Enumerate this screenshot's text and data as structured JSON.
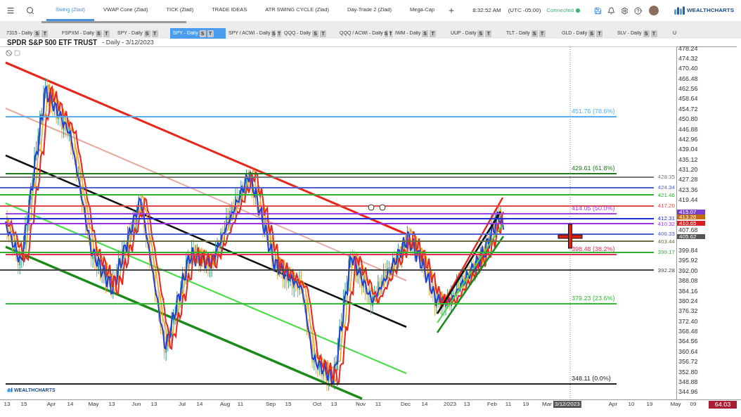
{
  "top_bar": {
    "layouts": [
      {
        "label": "Swing (Ziad)",
        "selected": true
      },
      {
        "label": "VWAP Cone (Ziad)",
        "selected": false
      },
      {
        "label": "TICK (Ziad)",
        "selected": false
      },
      {
        "label": "TRADE IDEAS",
        "selected": false
      },
      {
        "label": "ATR SWING CYCLE (Ziad)",
        "selected": false
      },
      {
        "label": "Day-Trade 2 (Ziad)",
        "selected": false
      },
      {
        "label": "Mega-Cap",
        "selected": false
      }
    ],
    "time": "8:32:52 AM",
    "timezone": "(UTC -05:00)",
    "status": "Connected",
    "connected": true,
    "logo": "WEALTHCHARTS"
  },
  "chart_tabs": [
    {
      "label": "7315 - Daily",
      "buttons": [
        "S",
        "T"
      ],
      "selected": false
    },
    {
      "label": "FSPXM - Daily",
      "buttons": [
        "S",
        "T"
      ],
      "selected": false
    },
    {
      "label": "SPY - Daily",
      "buttons": [
        "S",
        "T"
      ],
      "selected": false
    },
    {
      "label": "SPY - Daily",
      "buttons": [
        "S",
        "T"
      ],
      "selected": true
    },
    {
      "label": "SPY / ACWI - Daily",
      "buttons": [
        "S",
        "T"
      ],
      "selected": false
    },
    {
      "label": "QQQ - Daily",
      "buttons": [
        "S",
        "T"
      ],
      "selected": false
    },
    {
      "label": "QQQ / ACWI - Daily",
      "buttons": [
        "S",
        "T"
      ],
      "selected": false
    },
    {
      "label": "IWM - Daily",
      "buttons": [
        "S",
        "T"
      ],
      "selected": false
    },
    {
      "label": "UUP - Daily",
      "buttons": [
        "S",
        "T"
      ],
      "selected": false
    },
    {
      "label": "TLT - Daily",
      "buttons": [
        "S",
        "T"
      ],
      "selected": false
    },
    {
      "label": "GLD - Daily",
      "buttons": [
        "S",
        "T"
      ],
      "selected": false
    },
    {
      "label": "SLV - Daily",
      "buttons": [
        "S",
        "T"
      ],
      "selected": false
    },
    {
      "label": "U",
      "selected": false
    }
  ],
  "chart": {
    "title": "SPDR S&P 500 ETF TRUST",
    "subtitle": "- Daily - 3/12/2023",
    "watermark": "WEALTHCHARTS",
    "fib_levels": [
      {
        "label": "451.76 (78.6%)",
        "color": "#5aaef0"
      },
      {
        "label": "429.61 (61.8%)",
        "color": "#1f7a1f"
      },
      {
        "label": "414.05 (50.0%)",
        "color": "#a040e0"
      },
      {
        "label": "398.48 (38.2%)",
        "color": "#e0304f"
      },
      {
        "label": "379.23 (23.6%)",
        "color": "#33bb33"
      },
      {
        "label": "348.11 (0.0%)",
        "color": "#222222"
      }
    ],
    "levels": [
      {
        "label": "428.35",
        "color": "#777777"
      },
      {
        "label": "424.34",
        "color": "#5060d0"
      },
      {
        "label": "421.46",
        "color": "#30b030"
      },
      {
        "label": "417.20",
        "color": "#e04848"
      },
      {
        "label": "412.31",
        "color": "#2030d0"
      },
      {
        "label": "410.32",
        "color": "#9b30e0"
      },
      {
        "label": "406.33",
        "color": "#5060d0"
      },
      {
        "label": "403.44",
        "color": "#6b6b40"
      },
      {
        "label": "399.17",
        "color": "#30b030"
      },
      {
        "label": "392.28",
        "color": "#444444"
      }
    ],
    "price_axis": [
      "478.24",
      "474.32",
      "470.40",
      "466.48",
      "462.56",
      "458.64",
      "454.72",
      "450.80",
      "446.88",
      "442.96",
      "439.04",
      "435.12",
      "431.20",
      "427.28",
      "423.36",
      "419.44",
      "407.68",
      "399.84",
      "395.92",
      "392.00",
      "388.08",
      "384.16",
      "380.24",
      "376.32",
      "372.40",
      "368.48",
      "364.56",
      "360.64",
      "356.72",
      "352.80",
      "348.88",
      "344.96"
    ],
    "price_badges": [
      {
        "label": "415.07",
        "color": "#7b3fd0"
      },
      {
        "label": "413.26",
        "color": "#c06a10"
      },
      {
        "label": "410.65",
        "color": "#d42020"
      },
      {
        "label": "405.62",
        "color": "#555555"
      }
    ],
    "time_axis": [
      "13",
      "15",
      "Apr",
      "14",
      "May",
      "13",
      "Jun",
      "13",
      "Jul",
      "14",
      "Aug",
      "11",
      "Sep",
      "15",
      "Oct",
      "13",
      "Nov",
      "11",
      "Dec",
      "14",
      "2023",
      "13",
      "Feb",
      "11",
      "19",
      "Mar",
      "Apr",
      "10",
      "19",
      "May",
      "09"
    ],
    "cursor_date": "3/12/2023",
    "indicator_value": "64.03"
  }
}
